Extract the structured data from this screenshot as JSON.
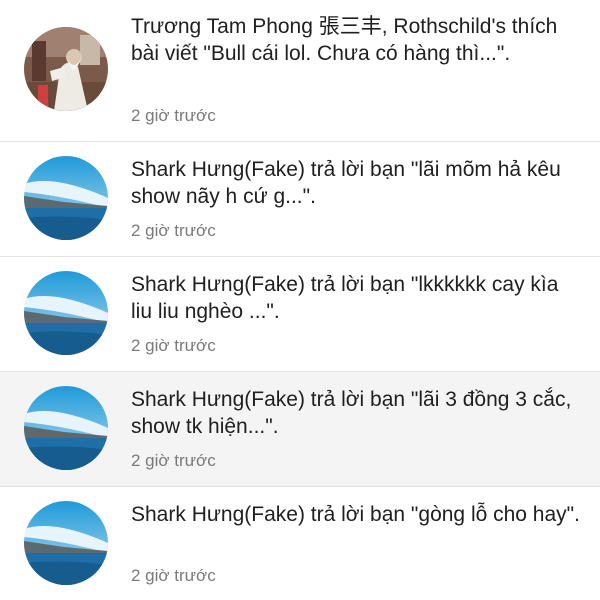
{
  "notifications": [
    {
      "text": "Trương Tam Phong 張三丰, Rothschild's thích bài viết \"Bull cái lol. Chưa có hàng thì...\".",
      "time": "2 giờ trước",
      "avatar": "monk-photo-avatar",
      "highlighted": false
    },
    {
      "text": "Shark Hưng(Fake) trả lời bạn \"lãi mõm hả kêu show nãy h cứ g...\".",
      "time": "2 giờ trước",
      "avatar": "sea-landscape-avatar",
      "highlighted": false
    },
    {
      "text": "Shark Hưng(Fake) trả lời bạn \"lkkkkkk cay kìa liu liu nghèo ...\".",
      "time": "2 giờ trước",
      "avatar": "sea-landscape-avatar",
      "highlighted": false
    },
    {
      "text": "Shark Hưng(Fake) trả lời bạn \"lãi 3 đồng 3 cắc, show tk hiện...\".",
      "time": "2 giờ trước",
      "avatar": "sea-landscape-avatar",
      "highlighted": true
    },
    {
      "text": "Shark Hưng(Fake) trả lời bạn \"gòng lỗ cho hay\".",
      "time": "2 giờ trước",
      "avatar": "sea-landscape-avatar",
      "highlighted": false
    }
  ]
}
